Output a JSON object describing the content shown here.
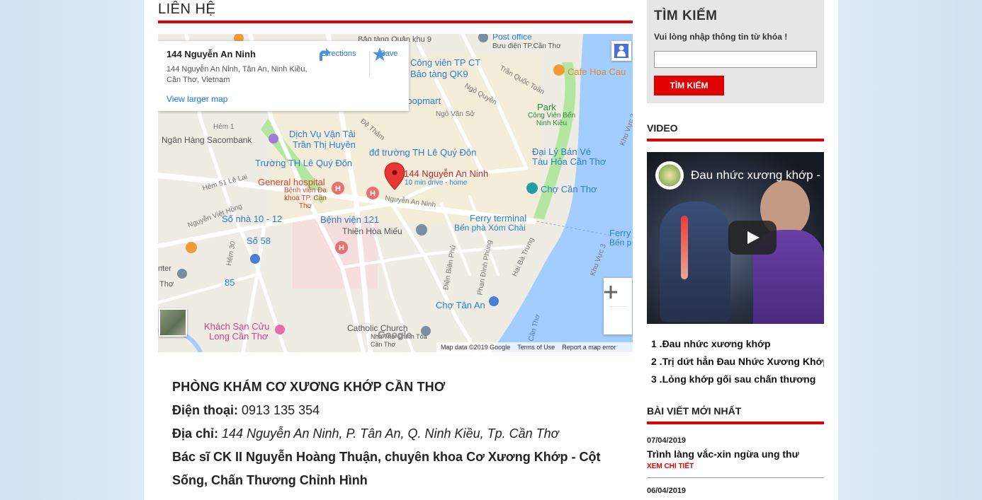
{
  "main": {
    "section_title": "LIÊN HỆ"
  },
  "map": {
    "info_card": {
      "title": "144 Nguyễn An Ninh",
      "address": "144 Nguyễn An Ninh, Tân An, Ninh Kiều, Cần Thơ, Vietnam",
      "directions_label": "Directions",
      "save_label": "Save",
      "larger_map_link": "View larger map"
    },
    "pin_label": "144 Nguyễn An Ninh",
    "pin_sub": "10 min drive - home",
    "labels": {
      "museum": "Bảo tàng Quân khu 9",
      "post_office": "Post office",
      "post_office_sub": "Bưu điện TP.Cần Thơ",
      "park_ct": "Công viên TP CT",
      "museum_qk9": "Bảo tàng QK9",
      "tran_quoc_toan": "Trần Quốc Toản",
      "cafe": "Cafe Hoa Cau",
      "park": "Park",
      "park_sub": "Công Viên Bến Ninh Kiều",
      "coopmart": "Coopmart",
      "ngo_quyen": "Ngô Quyền",
      "ngo_van_so": "Ngô Văn Sở",
      "hem1": "Hẻm 1",
      "de_tham": "Đề Thám",
      "sacombank": "Ngân Hàng Sacombank",
      "van_tai": "Dịch Vụ Vận Tải",
      "van_tai_sub": "Trần Thị Huyền",
      "le_quy_don_school": "đđ trường TH Lê Quý Đôn",
      "dai_ly_ve": "Đại Lý Bán Vé",
      "dai_ly_ve_sub": "Tàu Hỏa Cần Thơ",
      "truong_th": "Trường TH Lê Quý Đôn",
      "general_hospital": "General hospital",
      "general_hospital_sub": "Bệnh viện Đa khoa TP. Cần Thơ",
      "cho_can_tho": "Chợ Cần Thơ",
      "hem51": "Hẻm 51 Lê Lai",
      "nguyen_an_ninh_road": "Nguyễn An Ninh",
      "viet_hong": "Nguyễn Việt Hồng",
      "so_nha": "Số nhà 10 - 12",
      "benh_vien_121": "Bệnh viện 121",
      "thien_hoa_mieu": "Thiên Hòa Miếu",
      "ferry_terminal": "Ferry terminal",
      "ferry_sub": "Bến phà Xóm Chài",
      "ferry_right": "Ferry",
      "ferry_right_sub": "Bến p",
      "so_58": "Số 58",
      "hem30": "Hẻm 30",
      "bien_phu": "Điện Biên Phủ",
      "phan_dinh_phung": "Phan Đình Phùng",
      "hai_ba_trung": "Hai Bà Trưng",
      "khu_vuc3": "Khu Vực 3",
      "khu_vuc3_top": "Khu Vực 3",
      "center": "nter",
      "center_sub": "Thơ",
      "so_85": "85",
      "cho_tan_an": "Chợ Tân An",
      "khach_san": "Khách Sạn Cửu",
      "khach_san_sub": "Long Cần Thơ",
      "catholic": "Catholic Church",
      "catholic_sub": "Nhà Thờ Chính Tòa Cần Thơ",
      "song_can_tho": "Cần Thơ"
    },
    "google_logo": "Google",
    "footer": {
      "map_data": "Map data ©2019 Google",
      "terms": "Terms of Use",
      "report": "Report a map error"
    },
    "colors": {
      "water": "#a3ccff",
      "park": "#b3e6a1",
      "road": "#ffffff",
      "hospital": "#f6dbdb"
    }
  },
  "contact": {
    "clinic_name": "PHÒNG KHÁM CƠ XƯƠNG KHỚP CẦN THƠ",
    "phone_label": "Điện thoại:",
    "phone_value": "0913 135 354",
    "address_label": "Địa chỉ:",
    "address_value": "144 Nguyễn An Ninh, P. Tân An, Q. Ninh Kiều, Tp. Cần Thơ",
    "doctor": "Bác sĩ CK II Nguyễn Hoàng Thuận, chuyên khoa Cơ Xương Khớp - Cột Sống, Chấn Thương Chỉnh Hình"
  },
  "sidebar": {
    "search": {
      "title": "TÌM KIẾM",
      "hint": "Vui lòng nhập thông tin từ khóa !",
      "input_value": "",
      "button_label": "TÌM KIẾM"
    },
    "video_heading": "VIDEO",
    "video_title": "Đau nhức xương khớp - ",
    "video_list": [
      "1 .Đau nhức xương khớp",
      "2 .Trị dứt hẳn Đau Nhức Xương Khớp",
      "3 .Lỏng khớp gối sau chấn thương"
    ],
    "latest_heading": "BÀI VIẾT MỚI NHẤT",
    "posts": [
      {
        "date": "07/04/2019",
        "title": "Trình làng vắc-xin ngừa ung thư",
        "more": "XEM CHI TIẾT"
      },
      {
        "date": "06/04/2019"
      }
    ]
  },
  "accent_color": "#e10000"
}
